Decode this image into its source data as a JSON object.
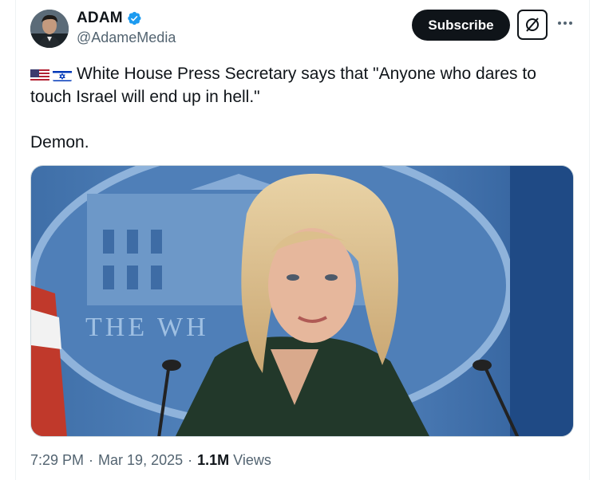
{
  "author": {
    "name": "ADAM",
    "handle": "@AdameMedia",
    "verified_color": "#1d9bf0",
    "avatar": "profile-photo"
  },
  "actions": {
    "subscribe_label": "Subscribe",
    "grok_icon": "grok-icon",
    "more_icon": "more-options-icon"
  },
  "post": {
    "flags": [
      "us-flag",
      "israel-flag"
    ],
    "text": "White House Press Secretary says that \"Anyone who dares to touch Israel will end up in hell.\"",
    "text_line2": "Demon.",
    "media": "photo of press secretary at White House briefing room podium"
  },
  "meta": {
    "time": "7:29 PM",
    "date": "Mar 19, 2025",
    "views_count": "1.1M",
    "views_label": "Views"
  },
  "colors": {
    "text": "#0f1419",
    "secondary": "#536471",
    "accent": "#1d9bf0"
  }
}
